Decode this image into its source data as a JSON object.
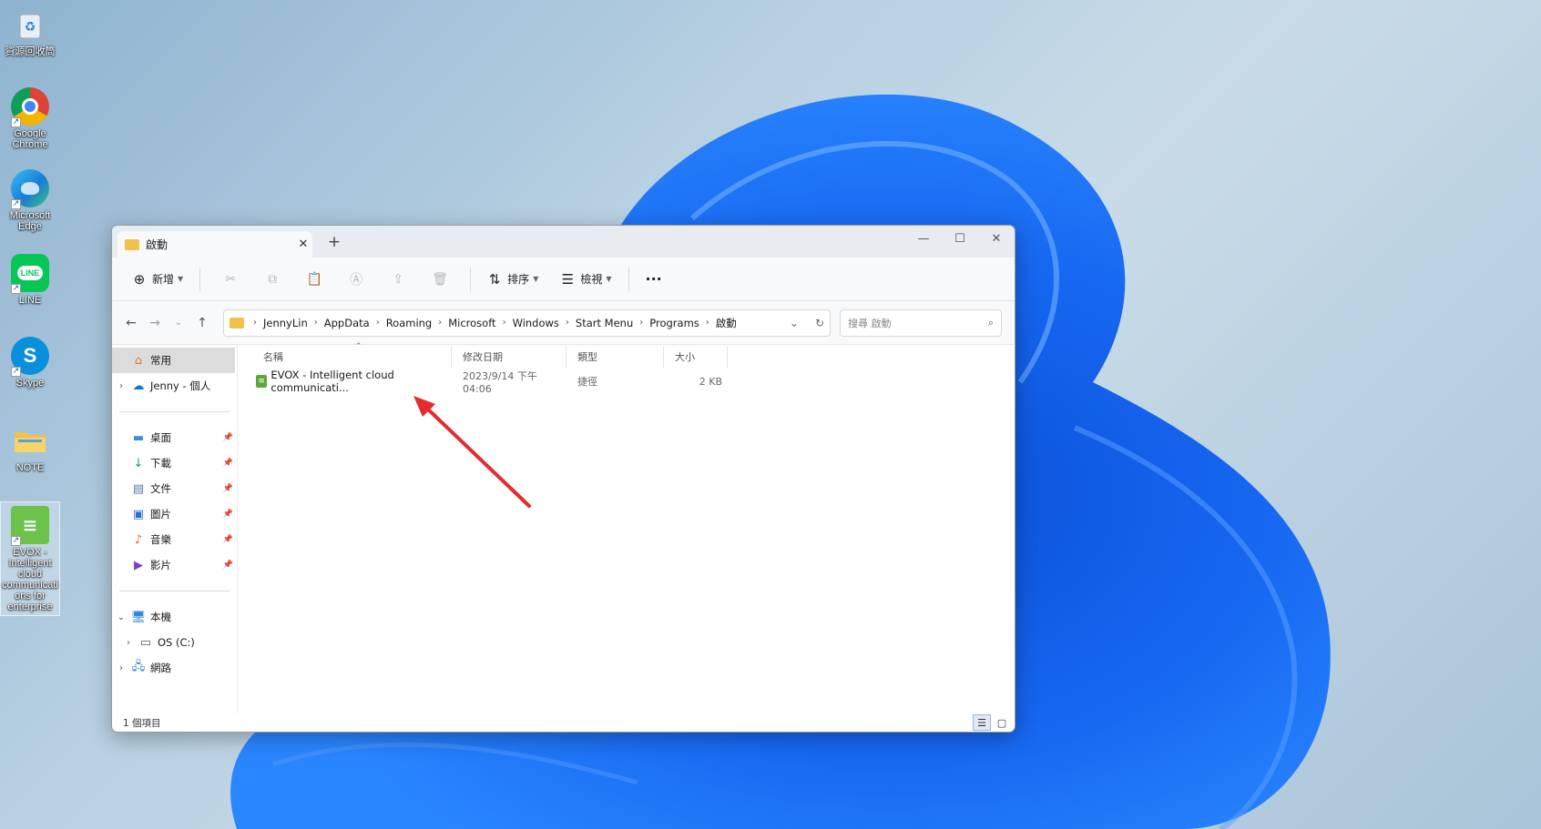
{
  "desktop": {
    "icons": [
      {
        "label": "資源回收筒",
        "icon": "recycle-bin-icon"
      },
      {
        "label": "Google Chrome",
        "icon": "chrome-icon"
      },
      {
        "label": "Microsoft Edge",
        "icon": "edge-icon"
      },
      {
        "label": "LINE",
        "icon": "line-icon"
      },
      {
        "label": "Skype",
        "icon": "skype-icon"
      },
      {
        "label": "NOTE",
        "icon": "folder-icon"
      },
      {
        "label": "EVOX - Intelligent cloud communications for enterprise",
        "icon": "evox-icon"
      }
    ]
  },
  "window": {
    "tab_title": "啟動",
    "new_tab_symbol": "+",
    "toolbar": {
      "new_label": "新增",
      "sort_label": "排序",
      "view_label": "檢視",
      "more_symbol": "···"
    },
    "address": {
      "crumbs": [
        "JennyLin",
        "AppData",
        "Roaming",
        "Microsoft",
        "Windows",
        "Start Menu",
        "Programs",
        "啟動"
      ],
      "search_placeholder": "搜尋 啟動"
    },
    "nav": {
      "home": "常用",
      "onedrive": "Jenny - 個人",
      "quick": [
        {
          "label": "桌面",
          "icon": "desktop-icon"
        },
        {
          "label": "下載",
          "icon": "download-icon"
        },
        {
          "label": "文件",
          "icon": "documents-icon"
        },
        {
          "label": "圖片",
          "icon": "pictures-icon"
        },
        {
          "label": "音樂",
          "icon": "music-icon"
        },
        {
          "label": "影片",
          "icon": "videos-icon"
        }
      ],
      "this_pc": "本機",
      "drive": "OS (C:)",
      "network": "網路"
    },
    "columns": {
      "name": "名稱",
      "modified": "修改日期",
      "type": "類型",
      "size": "大小"
    },
    "files": [
      {
        "name": "EVOX - Intelligent cloud communicati...",
        "modified": "2023/9/14 下午 04:06",
        "type": "捷徑",
        "size": "2 KB"
      }
    ],
    "status": "1 個項目"
  },
  "colors": {
    "annotation_arrow": "#e52b2b",
    "accent": "#0067c0"
  }
}
